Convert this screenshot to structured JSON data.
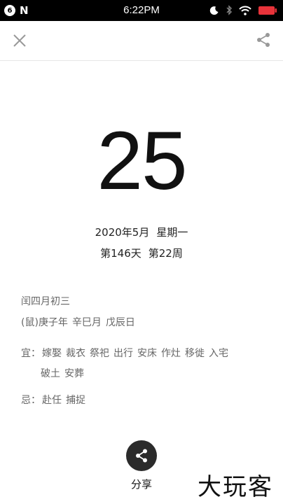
{
  "status_bar": {
    "badge": "6",
    "app_letter": "N",
    "time": "6:22PM",
    "icons": [
      "moon-icon",
      "bluetooth-icon",
      "wifi-icon",
      "battery-icon"
    ],
    "battery_color": "#e8333a"
  },
  "header": {
    "close_icon": "close-icon",
    "share_icon": "share-icon"
  },
  "day_number": "25",
  "date": {
    "year_month": "2020年5月",
    "weekday": "星期一",
    "day_of_year": "第146天",
    "week_of_year": "第22周"
  },
  "almanac": {
    "lunar_date": "闰四月初三",
    "zodiac": "(鼠)",
    "year_ganzhi": "庚子年",
    "month_ganzhi": "辛巳月",
    "day_ganzhi": "戊辰日",
    "yi_label": "宜：",
    "yi_items": [
      "嫁娶",
      "裁衣",
      "祭祀",
      "出行",
      "安床",
      "作灶",
      "移徙",
      "入宅",
      "破土",
      "安葬"
    ],
    "ji_label": "忌：",
    "ji_items": [
      "赴任",
      "捕捉"
    ]
  },
  "footer": {
    "share_label": "分享"
  },
  "watermark": "大玩客",
  "colors": {
    "status_bar_bg": "#000000",
    "fab_bg": "#2b2b2b",
    "muted_text": "#666666"
  }
}
